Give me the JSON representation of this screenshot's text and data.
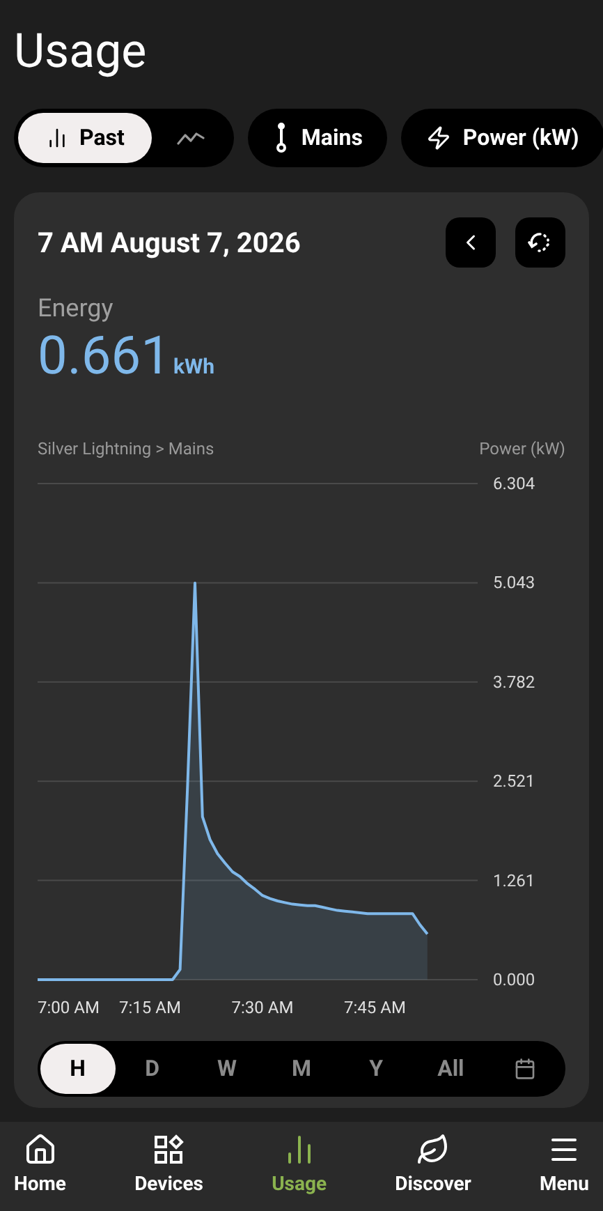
{
  "header": {
    "title": "Usage"
  },
  "view_toggle": [
    {
      "kind": "labeled",
      "label": "Past",
      "selected": true
    },
    {
      "kind": "icon",
      "selected": false
    }
  ],
  "filters": [
    {
      "label": "Mains"
    },
    {
      "label": "Power (kW)"
    }
  ],
  "card": {
    "date": "7 AM August 7, 2026",
    "metric_label": "Energy",
    "metric_value": "0.661",
    "metric_unit": "kWh",
    "chart_data": {
      "type": "area",
      "title": "Silver Lightning > Mains",
      "ylabel": "Power (kW)",
      "categories": [
        "7:00 AM",
        null,
        null,
        null,
        null,
        null,
        null,
        null,
        null,
        null,
        null,
        null,
        null,
        null,
        null,
        "7:15 AM",
        null,
        null,
        null,
        null,
        null,
        null,
        null,
        null,
        null,
        null,
        null,
        null,
        null,
        null,
        "7:30 AM",
        null,
        null,
        null,
        null,
        null,
        null,
        null,
        null,
        null,
        null,
        null,
        null,
        null,
        null,
        "7:45 AM",
        null,
        null,
        null,
        null,
        null,
        null,
        null,
        null,
        null,
        null,
        null,
        null,
        null
      ],
      "series": [
        {
          "color": "#7fb8ea",
          "values": [
            0,
            0,
            0,
            0,
            0,
            0,
            0,
            0,
            0,
            0,
            0,
            0,
            0,
            0,
            0,
            0,
            0,
            0,
            0,
            0.13,
            2.47,
            5.04,
            2.07,
            1.78,
            1.6,
            1.48,
            1.37,
            1.31,
            1.22,
            1.15,
            1.07,
            1.03,
            1.0,
            0.98,
            0.96,
            0.95,
            0.94,
            0.94,
            0.92,
            0.9,
            0.88,
            0.87,
            0.86,
            0.85,
            0.84,
            0.84,
            0.84,
            0.84,
            0.84,
            0.84,
            0.84,
            0.7,
            0.58,
            null,
            null,
            null,
            null,
            null,
            null
          ]
        }
      ],
      "ylim": [
        0,
        6.304
      ],
      "grid": true,
      "yticks": [
        {
          "value": 0,
          "label": "0.000"
        },
        {
          "value": 1.261,
          "label": "1.261"
        },
        {
          "value": 2.521,
          "label": "2.521"
        },
        {
          "value": 3.782,
          "label": "3.782"
        },
        {
          "value": 5.043,
          "label": "5.043"
        },
        {
          "value": 6.304,
          "label": "6.304"
        }
      ]
    },
    "ranges": [
      {
        "label": "H",
        "selected": true
      },
      {
        "label": "D",
        "selected": false
      },
      {
        "label": "W",
        "selected": false
      },
      {
        "label": "M",
        "selected": false
      },
      {
        "label": "Y",
        "selected": false
      },
      {
        "label": "All",
        "selected": false
      }
    ]
  },
  "nav": [
    {
      "label": "Home",
      "selected": false
    },
    {
      "label": "Devices",
      "selected": false
    },
    {
      "label": "Usage",
      "selected": true
    },
    {
      "label": "Discover",
      "selected": false
    },
    {
      "label": "Menu",
      "selected": false
    }
  ]
}
